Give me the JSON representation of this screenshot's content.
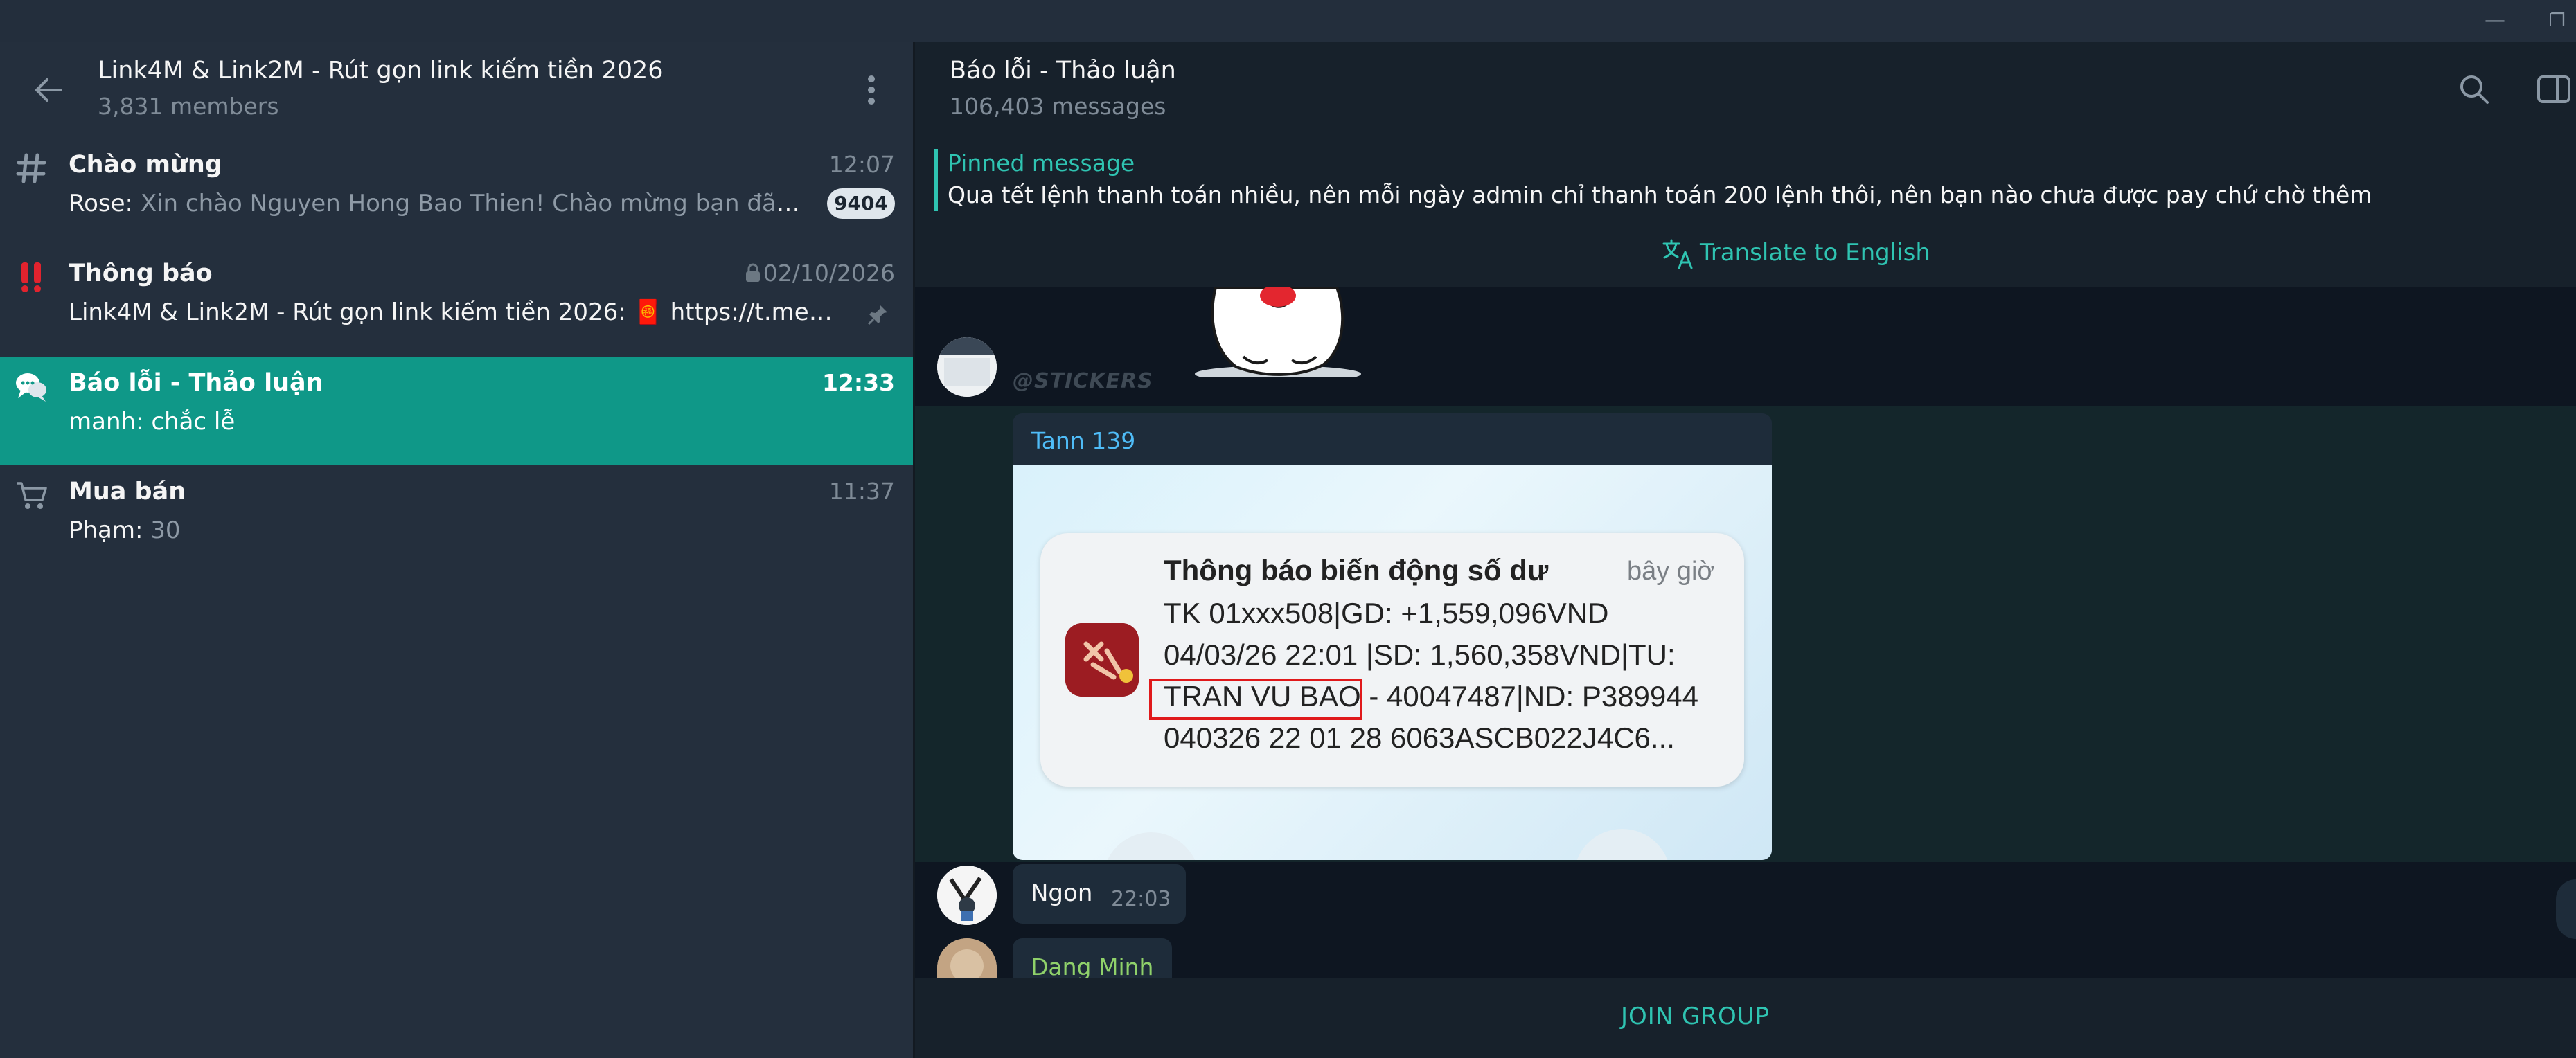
{
  "window": {
    "minimize_glyph": "—",
    "maximize_glyph": "❐"
  },
  "group": {
    "title": "Link4M & Link2M - Rút gọn link kiếm tiền 2026",
    "members": "3,831 members"
  },
  "topics": [
    {
      "name": "Chào mừng",
      "time": "12:07",
      "sender": "Rose:",
      "preview": "Xin chào Nguyen Hong Bao Thien!  Chào mừng bạn đã tham gi...",
      "badge": "9404",
      "icon": "hash-icon"
    },
    {
      "name": "Thông báo",
      "time": "02/10/2026",
      "sender": "",
      "preview": "Link4M & Link2M - Rút gọn link kiếm tiền 2026: 🧧 https://t.me/link4m_...",
      "icon": "exclamation-icon",
      "locked": true,
      "pinned": true
    },
    {
      "name": "Báo lỗi - Thảo luận",
      "time": "12:33",
      "sender": "manh:",
      "preview": "chắc lễ",
      "icon": "speech-bubbles-icon",
      "active": true
    },
    {
      "name": "Mua bán",
      "time": "11:37",
      "sender": "Phạm:",
      "preview": "30",
      "icon": "shopping-cart-icon"
    }
  ],
  "chat": {
    "title": "Báo lỗi - Thảo luận",
    "subtitle": "106,403 messages",
    "pinned_label": "Pinned message",
    "pinned_text": "Qua tết lệnh thanh toán nhiều, nên mỗi ngày admin chỉ thanh toán 200 lệnh thôi, nên bạn nào chưa được pay chứ chờ thêm",
    "translate_label": "Translate to English",
    "sticker_watermark": "@STICKERS",
    "photo_sender": "Tann 139",
    "notification": {
      "title": "Thông báo biến động số dư",
      "when": "bây giờ",
      "line1": "TK 01xxx508|GD: +1,559,096VND",
      "line2": "04/03/26 22:01 |SD: 1,560,358VND|TU:",
      "line3_highlight": "TRAN VU BAO",
      "line3_rest": " - 40047487|ND: P389944",
      "line4": "040326 22 01 28 6063ASCB022J4C6..."
    },
    "messages": [
      {
        "text": "Ngon",
        "time": "22:03"
      },
      {
        "sender": "Dang Minh"
      }
    ],
    "join_label": "JOIN GROUP"
  },
  "colors": {
    "accent": "#0f9888",
    "link": "#4fbcf7",
    "pinned": "#2fc4b2",
    "highlight_box": "#e0191b",
    "sender_green": "#8fd16a"
  }
}
